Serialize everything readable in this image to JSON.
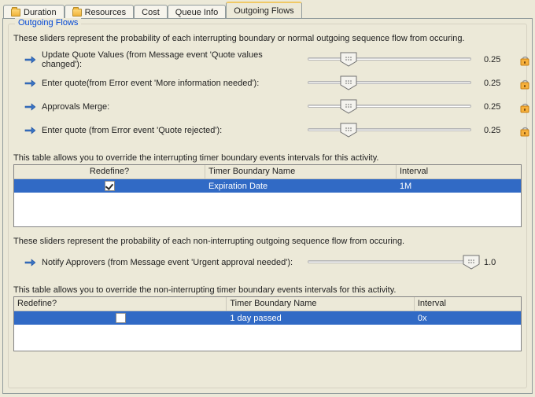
{
  "tabs": {
    "duration": "Duration",
    "resources": "Resources",
    "cost": "Cost",
    "queue": "Queue Info",
    "outgoing": "Outgoing Flows"
  },
  "group_title": "Outgoing Flows",
  "section_interrupting_desc": "These sliders represent the probability of each interrupting boundary or normal outgoing sequence flow from occuring.",
  "interrupting_sliders": [
    {
      "label": "Update Quote Values (from Message event 'Quote values changed'):",
      "value": "0.25",
      "pos": 0.25
    },
    {
      "label": "Enter quote(from Error event 'More information needed'):",
      "value": "0.25",
      "pos": 0.25
    },
    {
      "label": "Approvals Merge:",
      "value": "0.25",
      "pos": 0.25
    },
    {
      "label": "Enter quote (from Error event 'Quote rejected'):",
      "value": "0.25",
      "pos": 0.25
    }
  ],
  "interrupting_table_desc": "This table allows you to override the interrupting timer boundary events intervals for this activity.",
  "table_headers": {
    "redefine": "Redefine?",
    "name": "Timer Boundary Name",
    "interval": "Interval"
  },
  "interrupting_rows": [
    {
      "redefine": true,
      "name": "Expiration Date",
      "interval": "1M"
    }
  ],
  "section_noninterrupting_desc": "These sliders represent the probability of each non-interrupting outgoing sequence flow from occuring.",
  "noninterrupting_sliders": [
    {
      "label": "Notify Approvers (from Message event 'Urgent approval needed'):",
      "value": "1.0",
      "pos": 1.0
    }
  ],
  "noninterrupting_table_desc": "This table allows you to override the non-interrupting timer boundary events intervals for this activity.",
  "noninterrupting_rows": [
    {
      "redefine": false,
      "name": "1 day passed",
      "interval": "0x"
    }
  ]
}
